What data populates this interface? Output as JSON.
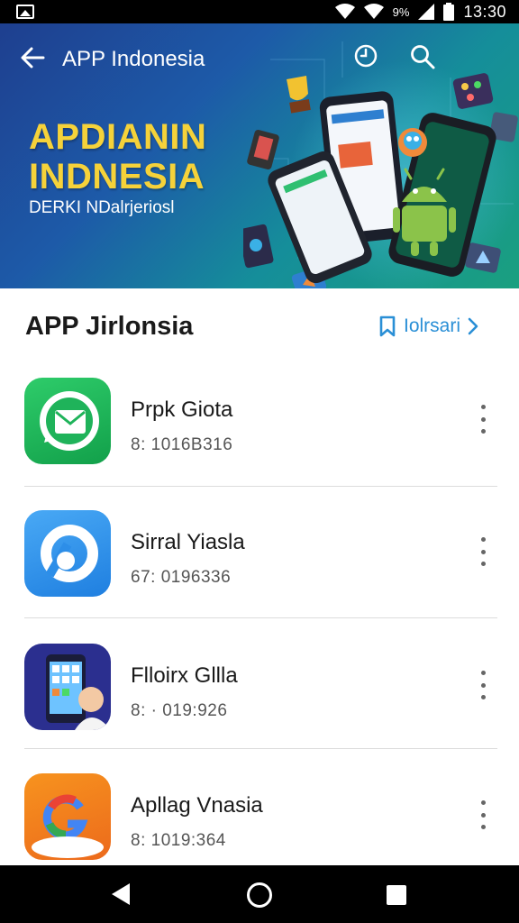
{
  "status_bar": {
    "time": "13:30",
    "signal_text": "9%"
  },
  "app_bar": {
    "title": "APP Indonesia"
  },
  "banner": {
    "headline_line1": "APDIANIN",
    "headline_line2": "INDNESIA",
    "subheadline": "DERKI NDalrjeriosl"
  },
  "section": {
    "title": "APP Jirlonsia",
    "action_label": "Iolrsari"
  },
  "apps": [
    {
      "name": "Prpk Giota",
      "meta": "8: 1016B316"
    },
    {
      "name": "Sirral Yiasla",
      "meta": "67: 0196336"
    },
    {
      "name": "Flloirx Gllla",
      "meta": "8: · 019:926"
    },
    {
      "name": "Apllag Vnasia",
      "meta": "8: 1019:364"
    }
  ],
  "colors": {
    "banner_start": "#1e3f8f",
    "banner_end": "#1aa07f",
    "headline": "#f5d23a",
    "accent": "#2a8fd6",
    "icon_green": "#1fb35a",
    "icon_blue": "#2d8ee8",
    "icon_indigo": "#2b2f8f",
    "icon_orange": "#f07a1c"
  }
}
